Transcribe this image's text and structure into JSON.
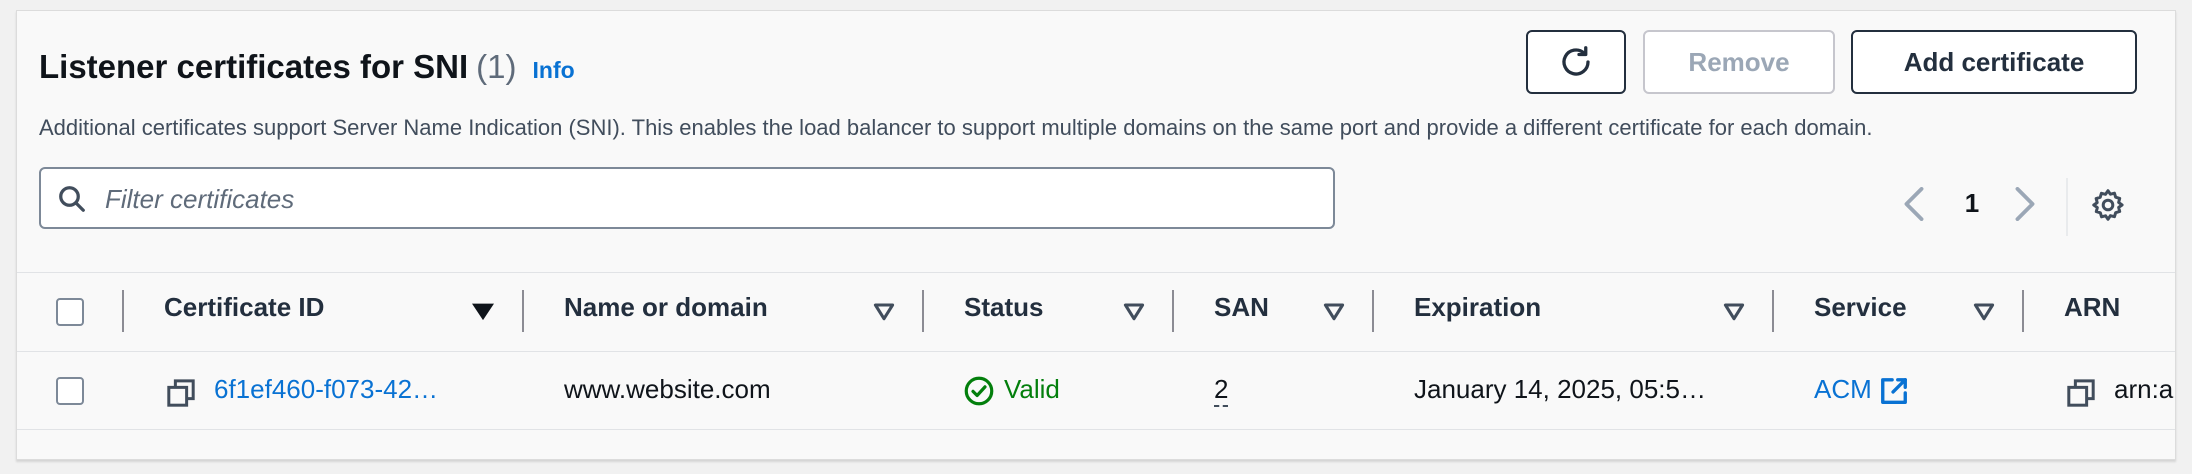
{
  "header": {
    "title": "Listener certificates for SNI",
    "count": "(1)",
    "info_label": "Info",
    "description": "Additional certificates support Server Name Indication (SNI). This enables the load balancer to support multiple domains on the same port and provide a different certificate for each domain."
  },
  "actions": {
    "refresh_icon": "refresh-icon",
    "remove_label": "Remove",
    "add_label": "Add certificate"
  },
  "filter": {
    "placeholder": "Filter certificates",
    "value": ""
  },
  "pagination": {
    "current_page": "1"
  },
  "table": {
    "columns": [
      "Certificate ID",
      "Name or domain",
      "Status",
      "SAN",
      "Expiration",
      "Service",
      "ARN"
    ],
    "rows": [
      {
        "certificate_id": "6f1ef460-f073-42…",
        "name_or_domain": "www.website.com",
        "status": "Valid",
        "san": "2",
        "expiration": "January 14, 2025, 05:5…",
        "service": "ACM",
        "arn": "arn:a"
      }
    ]
  },
  "colors": {
    "link": "#0972d3",
    "success": "#037f0c",
    "text": "#0f141a",
    "border": "#7d8998"
  }
}
